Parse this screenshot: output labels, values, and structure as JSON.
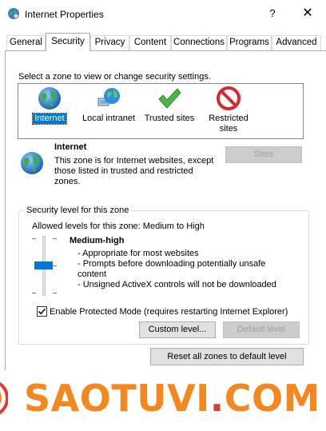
{
  "window": {
    "title": "Internet Properties",
    "help_glyph": "?",
    "close_glyph": "✕"
  },
  "tabs": [
    {
      "label": "General"
    },
    {
      "label": "Security"
    },
    {
      "label": "Privacy"
    },
    {
      "label": "Content"
    },
    {
      "label": "Connections"
    },
    {
      "label": "Programs"
    },
    {
      "label": "Advanced"
    }
  ],
  "active_tab": "Security",
  "security": {
    "zone_prompt": "Select a zone to view or change security settings.",
    "zones": [
      {
        "label": "Internet",
        "icon": "globe-icon",
        "selected": true
      },
      {
        "label": "Local intranet",
        "icon": "intranet-icon",
        "selected": false
      },
      {
        "label": "Trusted sites",
        "icon": "checkmark-icon",
        "selected": false
      },
      {
        "label": "Restricted sites",
        "icon": "prohibited-icon",
        "selected": false
      }
    ],
    "zone_detail": {
      "name": "Internet",
      "description": "This zone is for Internet websites, except those listed in trusted and restricted zones."
    },
    "sites_button": "Sites",
    "level_group_title": "Security level for this zone",
    "allowed_levels": "Allowed levels for this zone: Medium to High",
    "level": {
      "name": "Medium-high",
      "points": [
        "- Appropriate for most websites",
        "- Prompts before downloading potentially unsafe content",
        "- Unsigned ActiveX controls will not be downloaded"
      ]
    },
    "protected_mode": {
      "label": "Enable Protected Mode (requires restarting Internet Explorer)",
      "checked": true
    },
    "custom_level_button": "Custom level...",
    "default_level_button": "Default level",
    "reset_button": "Reset all zones to default level"
  },
  "watermark": {
    "text_main": "SAOTUVI",
    "text_dot": ".",
    "text_tld": "COM"
  },
  "colors": {
    "accent": "#0078d7",
    "brand_orange": "#f5871f",
    "brand_red": "#e23b2e"
  }
}
